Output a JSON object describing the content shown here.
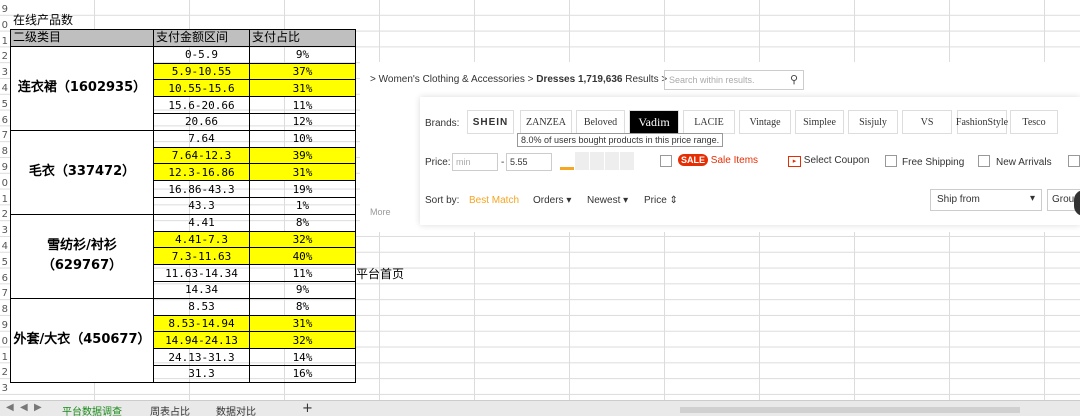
{
  "sheet": {
    "title": "在线产品数",
    "headers": [
      "二级类目",
      "支付金额区间",
      "支付占比"
    ],
    "groups": [
      {
        "category": "连衣裙（1602935）",
        "rows": [
          [
            "0-5.9",
            "9%",
            false
          ],
          [
            "5.9-10.55",
            "37%",
            true
          ],
          [
            "10.55-15.6",
            "31%",
            true
          ],
          [
            "15.6-20.66",
            "11%",
            false
          ],
          [
            "20.66",
            "12%",
            false
          ]
        ]
      },
      {
        "category": "毛衣（337472）",
        "rows": [
          [
            "7.64",
            "10%",
            false
          ],
          [
            "7.64-12.3",
            "39%",
            true
          ],
          [
            "12.3-16.86",
            "31%",
            true
          ],
          [
            "16.86-43.3",
            "19%",
            false
          ],
          [
            "43.3",
            "1%",
            false
          ]
        ]
      },
      {
        "category": "雪纺衫/衬衫（629767）",
        "rows": [
          [
            "4.41",
            "8%",
            false
          ],
          [
            "4.41-7.3",
            "32%",
            true
          ],
          [
            "7.3-11.63",
            "40%",
            true
          ],
          [
            "11.63-14.34",
            "11%",
            false
          ],
          [
            "14.34",
            "9%",
            false
          ]
        ]
      },
      {
        "category": "外套/大衣（450677）",
        "rows": [
          [
            "8.53",
            "8%",
            false
          ],
          [
            "8.53-14.94",
            "31%",
            true
          ],
          [
            "14.94-24.13",
            "32%",
            true
          ],
          [
            "24.13-31.3",
            "14%",
            false
          ],
          [
            "31.3",
            "16%",
            false
          ]
        ]
      }
    ],
    "note": "平台首页",
    "highlight_color": "#ffff00",
    "header_color": "#bfbfbf"
  },
  "screenshot": {
    "breadcrumb": "> Women's Clothing & Accessories > ",
    "crumb_current": "Dresses",
    "result_count": "1,719,636",
    "results_word": "Results >",
    "search_placeholder": "Search within results.",
    "more": "More",
    "brands_label": "Brands:",
    "brands": [
      "SHEIN",
      "ZANZEA",
      "Beloved",
      "Vadim",
      "LACIE",
      "Vintage",
      "Simplee",
      "Sisjuly",
      "VS",
      "FashionStyle",
      "Tesco"
    ],
    "tooltip": "8.0% of users bought products in this price range.",
    "price_label": "Price:",
    "price_min_placeholder": "min",
    "price_max": "5.55",
    "filters": {
      "sale_badge": "SALE",
      "sale_items": "Sale Items",
      "select_coupon": "Select Coupon",
      "free_shipping": "Free Shipping",
      "new_arrivals": "New Arrivals"
    },
    "sort_label": "Sort by:",
    "sort_options": [
      "Best Match",
      "Orders ▾",
      "Newest ▾",
      "Price ⇕"
    ],
    "ship_from": "Ship from",
    "group": "Grou",
    "accent": "#f5a623"
  },
  "tabs": [
    "平台数据调查",
    "周表占比",
    "数据对比"
  ]
}
